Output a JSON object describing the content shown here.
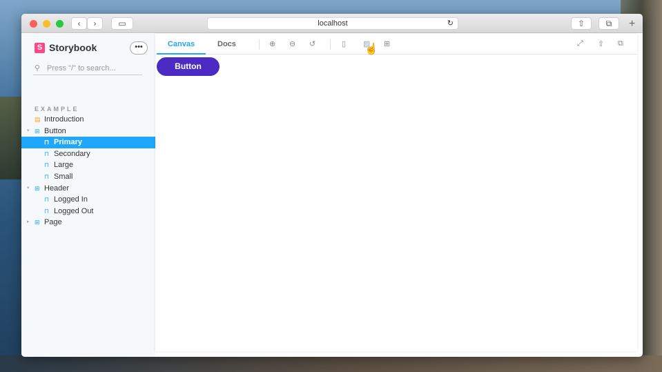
{
  "browser": {
    "url": "localhost",
    "back": "‹",
    "forward": "›",
    "new_tab": "+"
  },
  "sidebar": {
    "brand": "Storybook",
    "logo_letter": "S",
    "more": "•••",
    "search_placeholder": "Press \"/\" to search...",
    "section": "EXAMPLE",
    "items": [
      {
        "label": "Introduction",
        "icon": "document-icon",
        "level": 0
      },
      {
        "label": "Button",
        "icon": "component-icon",
        "level": 0,
        "expanded": true
      },
      {
        "label": "Primary",
        "icon": "bookmark-icon",
        "level": 1,
        "selected": true
      },
      {
        "label": "Secondary",
        "icon": "bookmark-icon",
        "level": 1
      },
      {
        "label": "Large",
        "icon": "bookmark-icon",
        "level": 1
      },
      {
        "label": "Small",
        "icon": "bookmark-icon",
        "level": 1
      },
      {
        "label": "Header",
        "icon": "component-icon",
        "level": 0,
        "expanded": true
      },
      {
        "label": "Logged In",
        "icon": "bookmark-icon",
        "level": 1
      },
      {
        "label": "Logged Out",
        "icon": "bookmark-icon",
        "level": 1
      },
      {
        "label": "Page",
        "icon": "component-icon",
        "level": 0,
        "expanded": false
      }
    ]
  },
  "toolbar": {
    "tabs": [
      "Canvas",
      "Docs"
    ],
    "active_tab": "Canvas"
  },
  "canvas": {
    "button_label": "Button"
  },
  "colors": {
    "accent": "#1ea7fd",
    "brand": "#ff4785",
    "primary_button": "#4b2bc4"
  }
}
